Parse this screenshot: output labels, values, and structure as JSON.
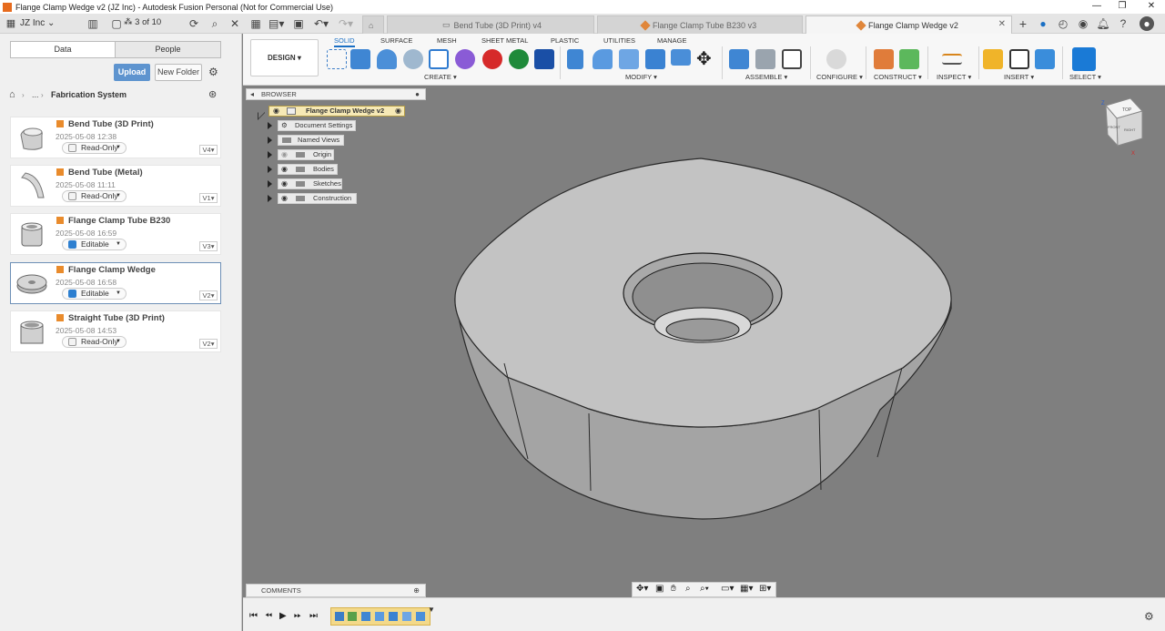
{
  "window": {
    "title": "Flange Clamp Wedge v2 (JZ Inc) - Autodesk Fusion Personal (Not for Commercial Use)",
    "minimize": "—",
    "maximize": "❐",
    "close": "✕"
  },
  "topbar": {
    "team": "JZ Inc",
    "counter": "3 of 10",
    "tabs": [
      {
        "label": "Bend Tube (3D Print) v4"
      },
      {
        "label": "Flange Clamp Tube B230 v3"
      },
      {
        "label": "Flange Clamp Wedge v2"
      }
    ]
  },
  "data_panel": {
    "tab_data": "Data",
    "tab_people": "People",
    "upload": "Upload",
    "new_folder": "New Folder",
    "breadcrumb_ellipsis": "...",
    "breadcrumb_current": "Fabrication System",
    "files": [
      {
        "name": "Bend Tube (3D Print)",
        "date": "2025-05-08 12:38",
        "status": "Read-Only",
        "version": "V4"
      },
      {
        "name": "Bend Tube (Metal)",
        "date": "2025-05-08 11:11",
        "status": "Read-Only",
        "version": "V1"
      },
      {
        "name": "Flange Clamp Tube B230",
        "date": "2025-05-08 16:59",
        "status": "Editable",
        "version": "V3"
      },
      {
        "name": "Flange Clamp Wedge",
        "date": "2025-05-08 16:58",
        "status": "Editable",
        "version": "V2"
      },
      {
        "name": "Straight Tube (3D Print)",
        "date": "2025-05-08 14:53",
        "status": "Read-Only",
        "version": "V2"
      }
    ]
  },
  "toolbar": {
    "workspace": "DESIGN",
    "tabs": [
      "SOLID",
      "SURFACE",
      "MESH",
      "SHEET METAL",
      "PLASTIC",
      "UTILITIES",
      "MANAGE"
    ],
    "groups": [
      "CREATE",
      "MODIFY",
      "ASSEMBLE",
      "CONFIGURE",
      "CONSTRUCT",
      "INSPECT",
      "INSERT",
      "SELECT"
    ]
  },
  "browser": {
    "title": "BROWSER",
    "root": "Flange Clamp Wedge v2",
    "nodes": [
      "Document Settings",
      "Named Views",
      "Origin",
      "Bodies",
      "Sketches",
      "Construction"
    ]
  },
  "comments": {
    "title": "COMMENTS"
  },
  "viewcube": {
    "top": "TOP",
    "front": "FRONT",
    "right": "RIGHT",
    "z": "Z",
    "x": "X"
  },
  "colors": {
    "accent": "#1a6fc4",
    "brand": "#e66b1e",
    "canvas": "#808080"
  }
}
